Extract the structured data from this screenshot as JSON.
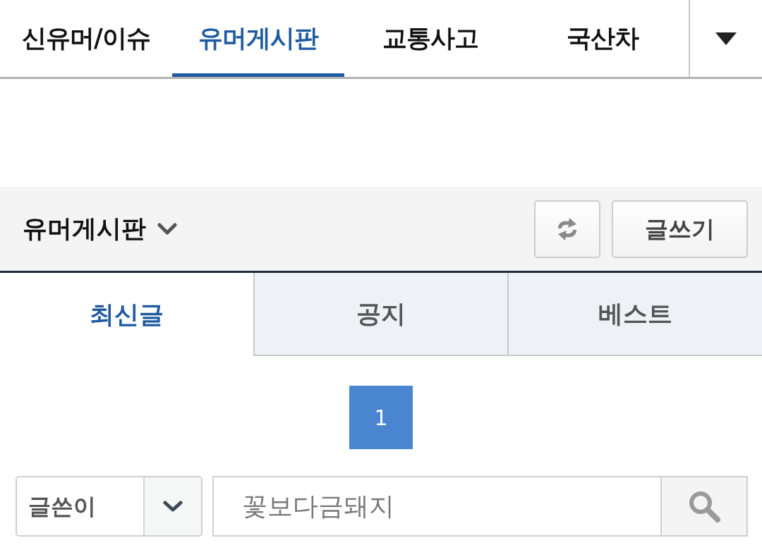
{
  "top_nav": {
    "tabs": [
      {
        "label": "신유머/이슈",
        "selected": false
      },
      {
        "label": "유머게시판",
        "selected": true
      },
      {
        "label": "교통사고",
        "selected": false
      },
      {
        "label": "국산차",
        "selected": false
      }
    ]
  },
  "board_header": {
    "title": "유머게시판",
    "write_button": {
      "label": "글쓰기"
    }
  },
  "list_tabs": [
    {
      "label": "최신글",
      "selected": true
    },
    {
      "label": "공지",
      "selected": false
    },
    {
      "label": "베스트",
      "selected": false
    }
  ],
  "pagination": [
    {
      "label": "1",
      "selected": true
    }
  ],
  "search": {
    "field_select": {
      "value": "글쓴이"
    },
    "query": {
      "value": "꽃보다금돼지"
    }
  }
}
